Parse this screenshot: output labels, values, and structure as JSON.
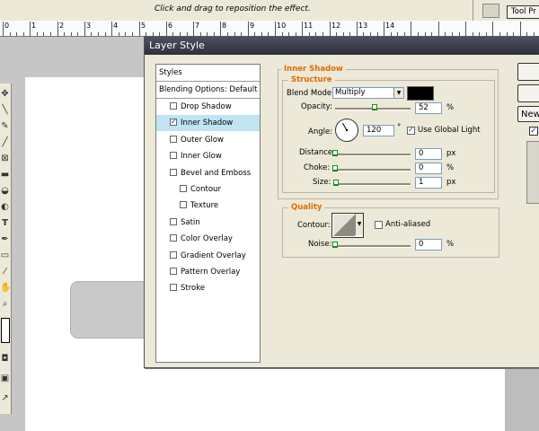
{
  "options_bar": {
    "hint": "Click and drag to reposition the effect.",
    "tool_presets_label": "Tool Pr"
  },
  "ruler": {
    "labels": [
      "0",
      "1",
      "2",
      "3",
      "4",
      "5",
      "6",
      "7",
      "8",
      "9",
      "10",
      "11",
      "12",
      "13",
      "14"
    ]
  },
  "dialog": {
    "title": "Layer Style",
    "styles_panel": {
      "header": "Styles",
      "blending": "Blending Options: Default",
      "items": [
        {
          "label": "Drop Shadow",
          "checked": false
        },
        {
          "label": "Inner Shadow",
          "checked": true
        },
        {
          "label": "Outer Glow",
          "checked": false
        },
        {
          "label": "Inner Glow",
          "checked": false
        },
        {
          "label": "Bevel and Emboss",
          "checked": false
        },
        {
          "label": "Contour",
          "checked": false
        },
        {
          "label": "Texture",
          "checked": false
        },
        {
          "label": "Satin",
          "checked": false
        },
        {
          "label": "Color Overlay",
          "checked": false
        },
        {
          "label": "Gradient Overlay",
          "checked": false
        },
        {
          "label": "Pattern Overlay",
          "checked": false
        },
        {
          "label": "Stroke",
          "checked": false
        }
      ]
    },
    "inner_shadow": {
      "section_title": "Inner Shadow",
      "structure_title": "Structure",
      "blend_mode_label": "Blend Mode:",
      "blend_mode_value": "Multiply",
      "shadow_color": "#000000",
      "opacity_label": "Opacity:",
      "opacity_value": "52",
      "opacity_unit": "%",
      "opacity_fraction": 0.52,
      "angle_label": "Angle:",
      "angle_value": "120",
      "angle_unit": "°",
      "use_global_light_label": "Use Global Light",
      "use_global_light": true,
      "distance_label": "Distance:",
      "distance_value": "0",
      "distance_unit": "px",
      "choke_label": "Choke:",
      "choke_value": "0",
      "choke_unit": "%",
      "size_label": "Size:",
      "size_value": "1",
      "size_unit": "px",
      "quality_title": "Quality",
      "contour_label": "Contour:",
      "anti_aliased_label": "Anti-aliased",
      "anti_aliased": false,
      "noise_label": "Noise:",
      "noise_value": "0",
      "noise_unit": "%"
    },
    "right": {
      "new_style_label": "New",
      "preview_checked": true
    }
  },
  "colors": {
    "dialog_bg": "#ece9d8",
    "selection": "#c1e4f3",
    "section_title": "#e06c00"
  }
}
